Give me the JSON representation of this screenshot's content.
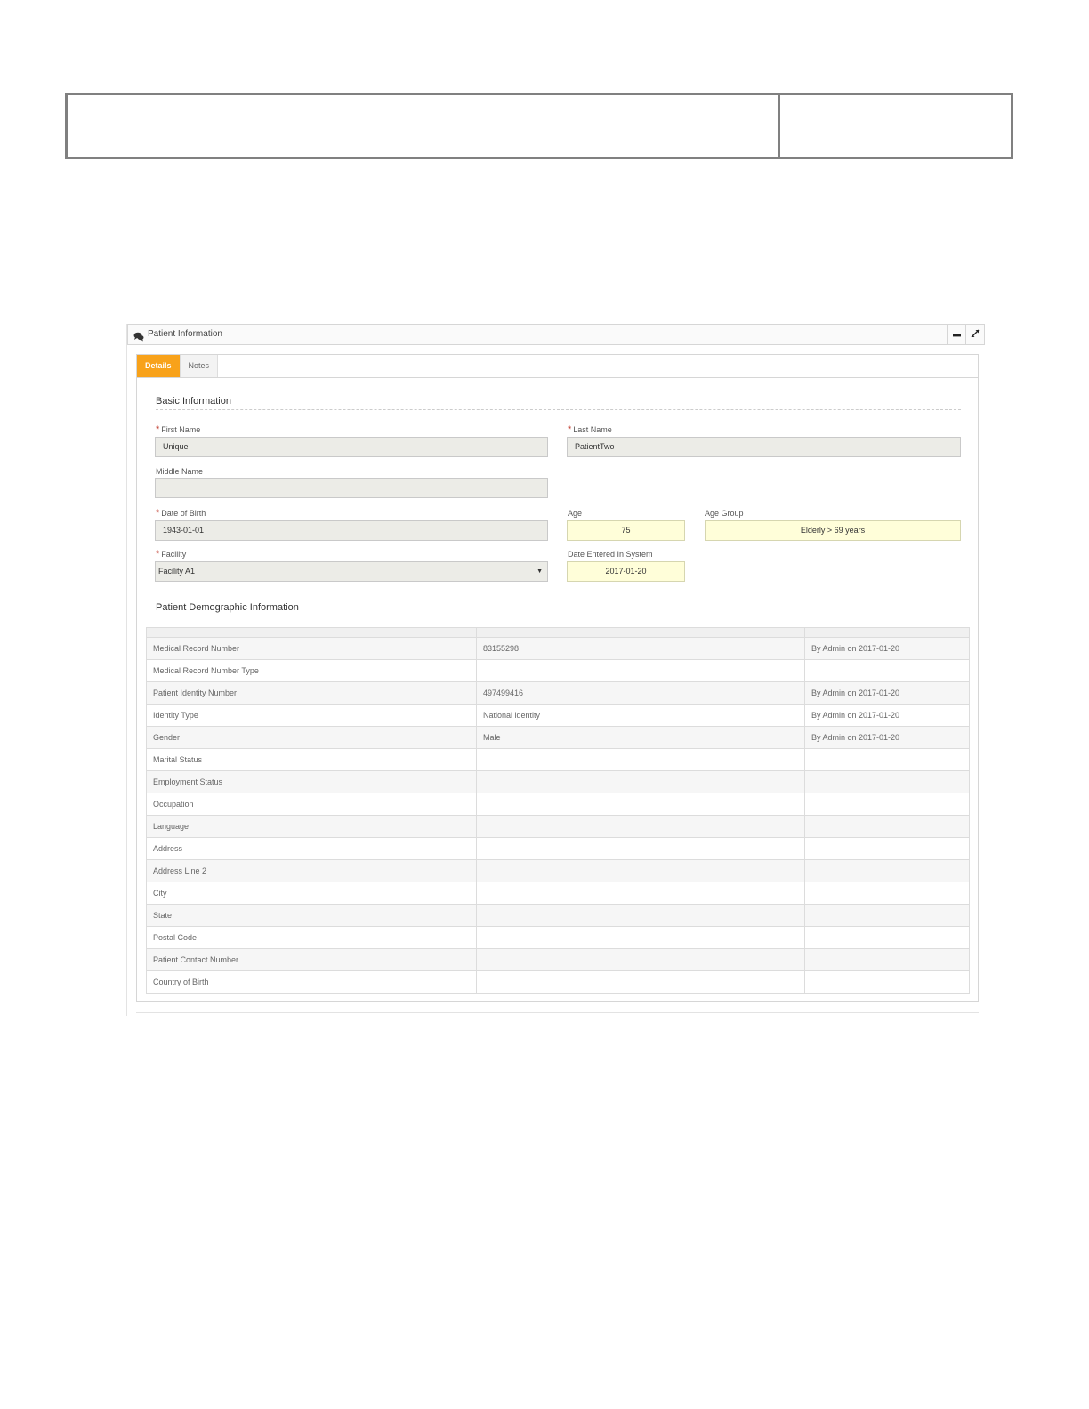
{
  "widget": {
    "title": "Patient Information",
    "icon": "comments-icon",
    "minimize_icon": "minus-icon",
    "expand_icon": "expand-icon"
  },
  "tabs": [
    {
      "label": "Details",
      "active": true
    },
    {
      "label": "Notes",
      "active": false
    }
  ],
  "basic_info": {
    "heading": "Basic Information",
    "first_name": {
      "label": "First Name",
      "value": "Unique",
      "required": true
    },
    "last_name": {
      "label": "Last Name",
      "value": "PatientTwo",
      "required": true
    },
    "middle_name": {
      "label": "Middle Name",
      "value": ""
    },
    "date_of_birth": {
      "label": "Date of Birth",
      "value": "1943-01-01",
      "required": true
    },
    "age": {
      "label": "Age",
      "value": "75"
    },
    "age_group": {
      "label": "Age Group",
      "value": "Elderly > 69 years"
    },
    "facility": {
      "label": "Facility",
      "value": "Facility A1",
      "required": true
    },
    "date_entered": {
      "label": "Date Entered In System",
      "value": "2017-01-20"
    }
  },
  "demographics": {
    "heading": "Patient Demographic Information",
    "rows": [
      {
        "field": "Medical Record Number",
        "value": "83155298",
        "audit": "By Admin on 2017-01-20"
      },
      {
        "field": "Medical Record Number Type",
        "value": "",
        "audit": ""
      },
      {
        "field": "Patient Identity Number",
        "value": "497499416",
        "audit": "By Admin on 2017-01-20"
      },
      {
        "field": "Identity Type",
        "value": "National identity",
        "audit": "By Admin on 2017-01-20"
      },
      {
        "field": "Gender",
        "value": "Male",
        "audit": "By Admin on 2017-01-20"
      },
      {
        "field": "Marital Status",
        "value": "",
        "audit": ""
      },
      {
        "field": "Employment Status",
        "value": "",
        "audit": ""
      },
      {
        "field": "Occupation",
        "value": "",
        "audit": ""
      },
      {
        "field": "Language",
        "value": "",
        "audit": ""
      },
      {
        "field": "Address",
        "value": "",
        "audit": ""
      },
      {
        "field": "Address Line 2",
        "value": "",
        "audit": ""
      },
      {
        "field": "City",
        "value": "",
        "audit": ""
      },
      {
        "field": "State",
        "value": "",
        "audit": ""
      },
      {
        "field": "Postal Code",
        "value": "",
        "audit": ""
      },
      {
        "field": "Patient Contact Number",
        "value": "",
        "audit": ""
      },
      {
        "field": "Country of Birth",
        "value": "",
        "audit": ""
      }
    ]
  },
  "colors": {
    "accent": "#f8a21a",
    "required": "#c0392b",
    "readonly_field": "#ecece7",
    "computed_field": "#fffed9"
  }
}
